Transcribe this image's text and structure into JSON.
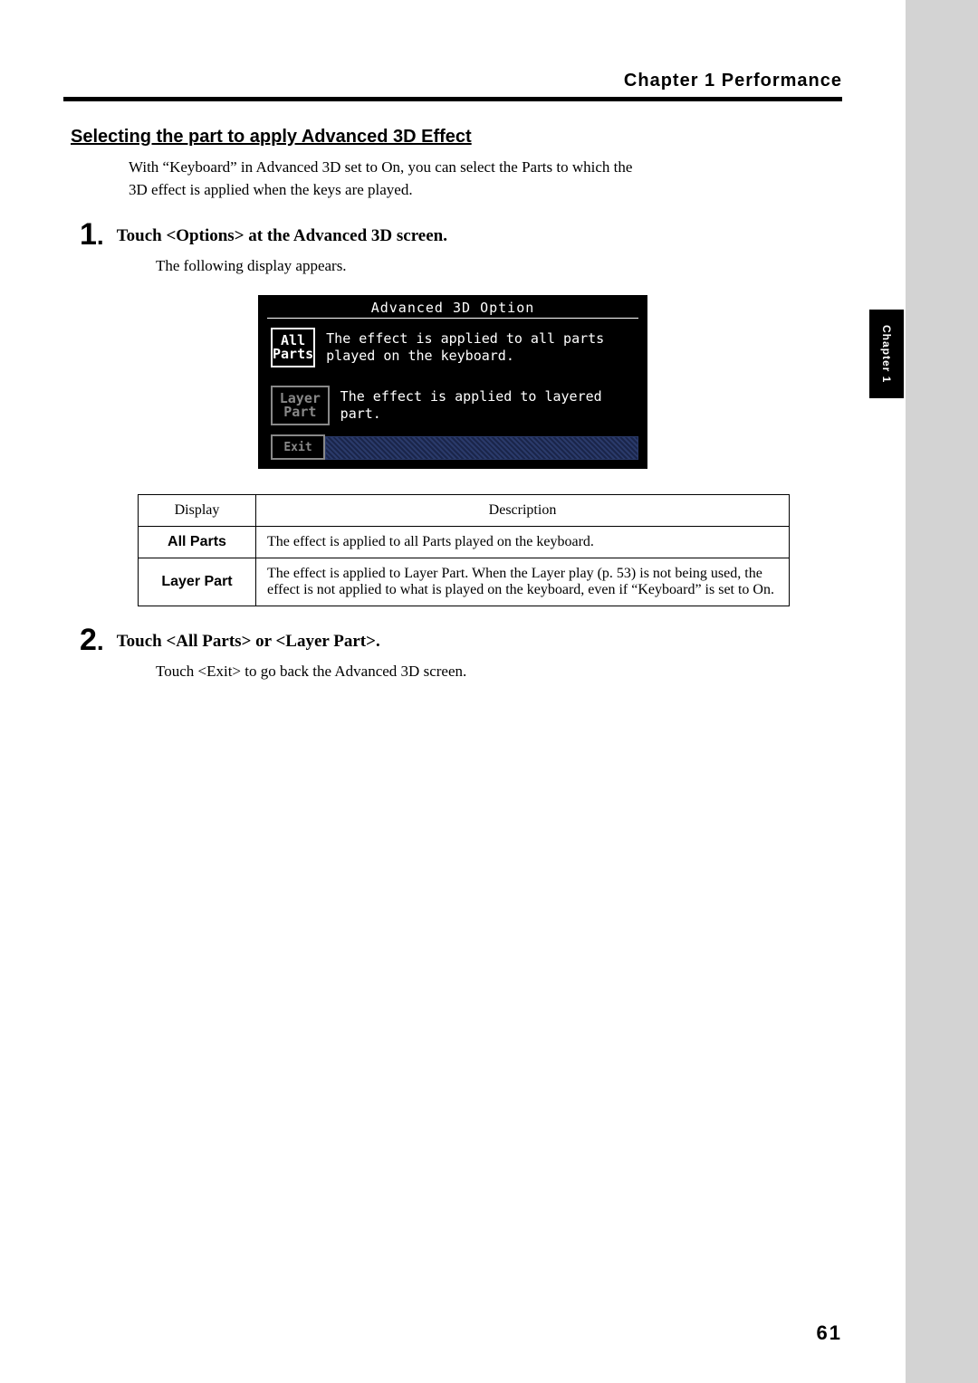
{
  "chapter_header": "Chapter 1  Performance",
  "section_title": "Selecting the part to apply Advanced 3D Effect",
  "intro": "With “Keyboard” in Advanced 3D set to On, you can select the Parts to which the 3D effect is applied when the keys are played.",
  "steps": {
    "s1": {
      "num": "1",
      "head": "Touch <Options> at the Advanced 3D screen.",
      "body": "The following display appears."
    },
    "s2": {
      "num": "2",
      "head": "Touch <All Parts> or <Layer Part>.",
      "body": "Touch <Exit> to go back the Advanced 3D screen."
    }
  },
  "lcd": {
    "title": "Advanced 3D Option",
    "btn_all_1": "All",
    "btn_all_2": "Parts",
    "desc_all": "The effect is applied to all parts played on the keyboard.",
    "btn_layer_1": "Layer",
    "btn_layer_2": "Part",
    "desc_layer": "The effect is applied to layered part.",
    "exit": "Exit"
  },
  "table": {
    "th_display": "Display",
    "th_desc": "Description",
    "r1_label": "All Parts",
    "r1_desc": "The effect is applied to all Parts played on the keyboard.",
    "r2_label": "Layer Part",
    "r2_desc": "The effect is applied to Layer Part. When the Layer play (p. 53) is not being used, the effect is not applied to what is played on the keyboard, even if “Keyboard” is set to On."
  },
  "side_tab": "Chapter 1",
  "page_number": "61"
}
